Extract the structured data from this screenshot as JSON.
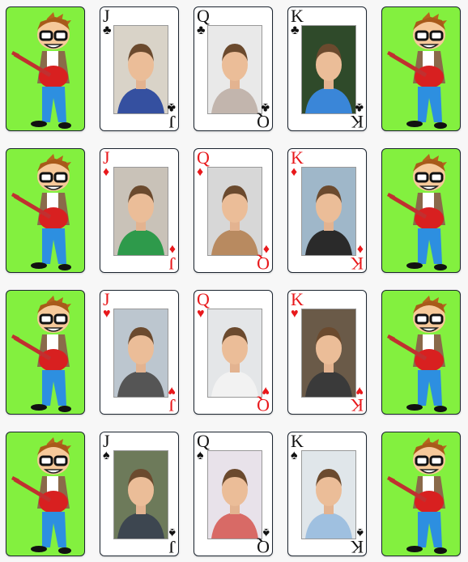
{
  "colors": {
    "back": "#83f03f",
    "red": "#e8181b",
    "black": "#111111"
  },
  "rows": [
    {
      "cards": [
        {
          "type": "back",
          "icon": "guitar-boy-icon"
        },
        {
          "type": "face",
          "rank": "J",
          "suit": "clubs",
          "symbol": "♣",
          "color": "black",
          "photo_bg": "#d9d3c8",
          "shirt": "#3550a0"
        },
        {
          "type": "face",
          "rank": "Q",
          "suit": "clubs",
          "symbol": "♣",
          "color": "black",
          "photo_bg": "#e9e9e9",
          "shirt": "#c2b5ad"
        },
        {
          "type": "face",
          "rank": "K",
          "suit": "clubs",
          "symbol": "♣",
          "color": "black",
          "photo_bg": "#2f4a2a",
          "shirt": "#3a86d8"
        },
        {
          "type": "back",
          "icon": "guitar-boy-icon"
        }
      ]
    },
    {
      "cards": [
        {
          "type": "back",
          "icon": "guitar-boy-icon"
        },
        {
          "type": "face",
          "rank": "J",
          "suit": "diamonds",
          "symbol": "♦",
          "color": "red",
          "photo_bg": "#c9c2b8",
          "shirt": "#2e9a4b"
        },
        {
          "type": "face",
          "rank": "Q",
          "suit": "diamonds",
          "symbol": "♦",
          "color": "red",
          "photo_bg": "#d7d7d7",
          "shirt": "#b88a60"
        },
        {
          "type": "face",
          "rank": "K",
          "suit": "diamonds",
          "symbol": "♦",
          "color": "red",
          "photo_bg": "#9fb7c9",
          "shirt": "#2a2a2a"
        },
        {
          "type": "back",
          "icon": "guitar-boy-icon"
        }
      ]
    },
    {
      "cards": [
        {
          "type": "back",
          "icon": "guitar-boy-icon"
        },
        {
          "type": "face",
          "rank": "J",
          "suit": "hearts",
          "symbol": "♥",
          "color": "red",
          "photo_bg": "#bcc6cf",
          "shirt": "#555555"
        },
        {
          "type": "face",
          "rank": "Q",
          "suit": "hearts",
          "symbol": "♥",
          "color": "red",
          "photo_bg": "#e4e6e8",
          "shirt": "#f2f2f2"
        },
        {
          "type": "face",
          "rank": "K",
          "suit": "hearts",
          "symbol": "♥",
          "color": "red",
          "photo_bg": "#6a5a48",
          "shirt": "#3a3a3a"
        },
        {
          "type": "back",
          "icon": "guitar-boy-icon"
        }
      ]
    },
    {
      "cards": [
        {
          "type": "back",
          "icon": "guitar-boy-icon"
        },
        {
          "type": "face",
          "rank": "J",
          "suit": "spades",
          "symbol": "♠",
          "color": "black",
          "photo_bg": "#6d7a5a",
          "shirt": "#3d4650"
        },
        {
          "type": "face",
          "rank": "Q",
          "suit": "spades",
          "symbol": "♠",
          "color": "black",
          "photo_bg": "#e8e2ea",
          "shirt": "#d86a66"
        },
        {
          "type": "face",
          "rank": "K",
          "suit": "spades",
          "symbol": "♠",
          "color": "black",
          "photo_bg": "#e0e6ea",
          "shirt": "#9fc0e0"
        },
        {
          "type": "back",
          "icon": "guitar-boy-icon"
        }
      ]
    }
  ]
}
